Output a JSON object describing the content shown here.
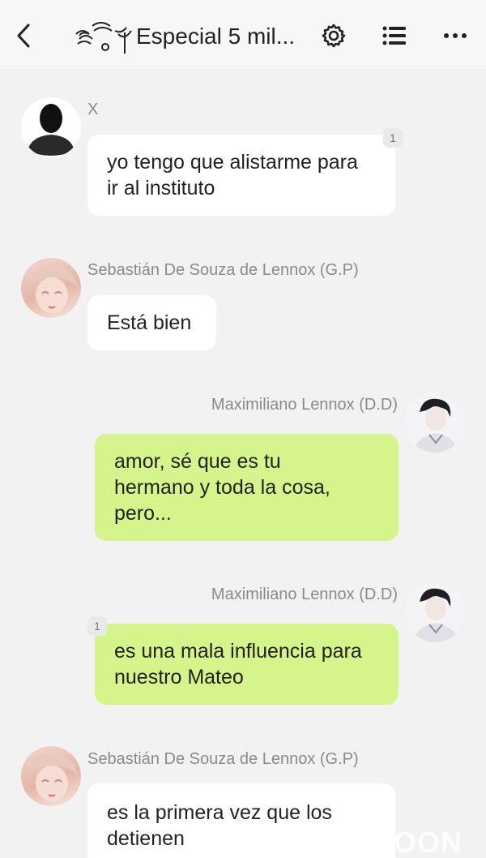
{
  "header": {
    "title": "Especial 5 mil...",
    "back_icon": "chevron-left-icon",
    "settings_icon": "gear-icon",
    "list_icon": "list-icon",
    "more_icon": "more-horizontal-icon"
  },
  "colors": {
    "incoming_bubble": "#ffffff",
    "outgoing_bubble": "#d6f48c",
    "background": "#f2f2f2"
  },
  "messages": [
    {
      "sender": "X",
      "text_lines": [
        "yo tengo que alistarme para",
        "ir al instituto"
      ],
      "count": "1",
      "direction": "in"
    },
    {
      "sender": "Sebastián De Souza de Lennox (G.P)",
      "text_lines": [
        "Está bien"
      ],
      "direction": "in"
    },
    {
      "sender": "Maximiliano Lennox (D.D)",
      "text_lines": [
        "amor, sé que es tu",
        "hermano y toda la cosa,",
        "pero..."
      ],
      "direction": "out"
    },
    {
      "sender": "Maximiliano Lennox (D.D)",
      "text_lines": [
        "es una mala influencia para",
        "nuestro Mateo"
      ],
      "count": "1",
      "direction": "out"
    },
    {
      "sender": "Sebastián De Souza de Lennox (G.P)",
      "text_lines": [
        "es la primera vez que los",
        "detienen"
      ],
      "direction": "in"
    }
  ],
  "watermark": "OON"
}
